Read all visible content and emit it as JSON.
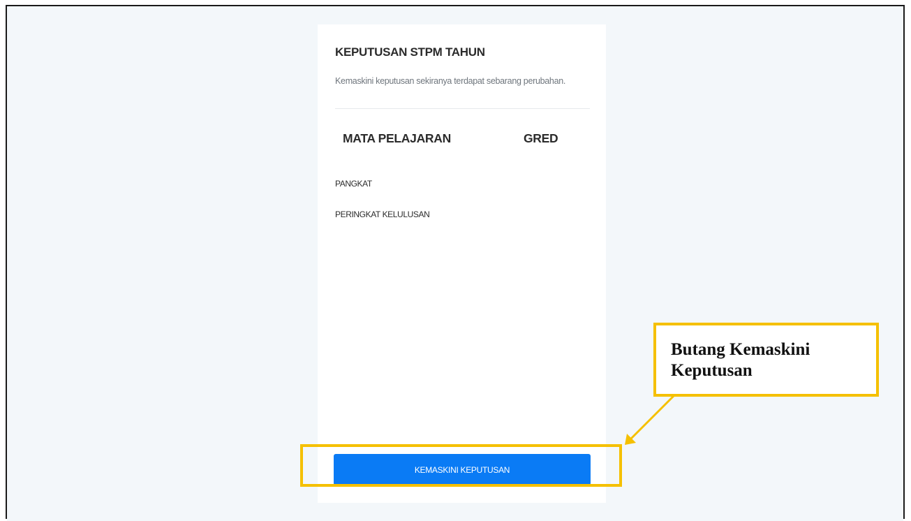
{
  "card": {
    "title": "KEPUTUSAN STPM TAHUN",
    "subtitle": "Kemaskini keputusan sekiranya terdapat sebarang perubahan.",
    "table_headers": [
      "MATA PELAJARAN",
      "GRED"
    ],
    "rows": [
      "PANGKAT",
      "PERINGKAT KELULUSAN"
    ],
    "update_button_label": "KEMASKINI KEPUTUSAN"
  },
  "annotation": {
    "callout_text": "Butang Kemaskini Keputusan",
    "highlight_color": "#f5c000"
  },
  "colors": {
    "background": "#f3f7fa",
    "primary_button": "#0a7bf5"
  }
}
